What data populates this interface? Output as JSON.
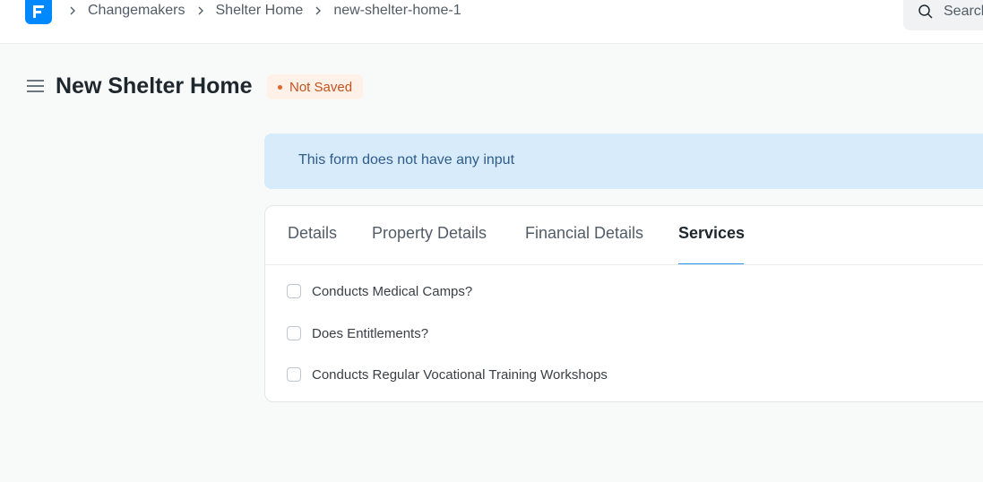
{
  "navbar": {
    "logo_icon": "frappe-logo-icon",
    "breadcrumbs": [
      "Changemakers",
      "Shelter Home",
      "new-shelter-home-1"
    ],
    "search": {
      "placeholder": "Search",
      "icon": "search-icon"
    }
  },
  "header": {
    "menu_icon": "hamburger-icon",
    "title": "New Shelter Home",
    "status": "Not Saved"
  },
  "alert": {
    "text": "This form does not have any input"
  },
  "form": {
    "tabs": [
      {
        "label": "Details",
        "active": false
      },
      {
        "label": "Property Details",
        "active": false
      },
      {
        "label": "Financial Details",
        "active": false
      },
      {
        "label": "Services",
        "active": true
      }
    ],
    "checkboxes": [
      {
        "label": "Conducts Medical Camps?",
        "checked": false
      },
      {
        "label": "Does Entitlements?",
        "checked": false
      },
      {
        "label": "Conducts Regular Vocational Training Workshops",
        "checked": false
      }
    ]
  },
  "colors": {
    "accent": "#2490ef",
    "logo": "#0089ff",
    "status_text": "#c4521f",
    "status_bg": "#fff1e7",
    "alert_bg": "#d7ebfb"
  }
}
